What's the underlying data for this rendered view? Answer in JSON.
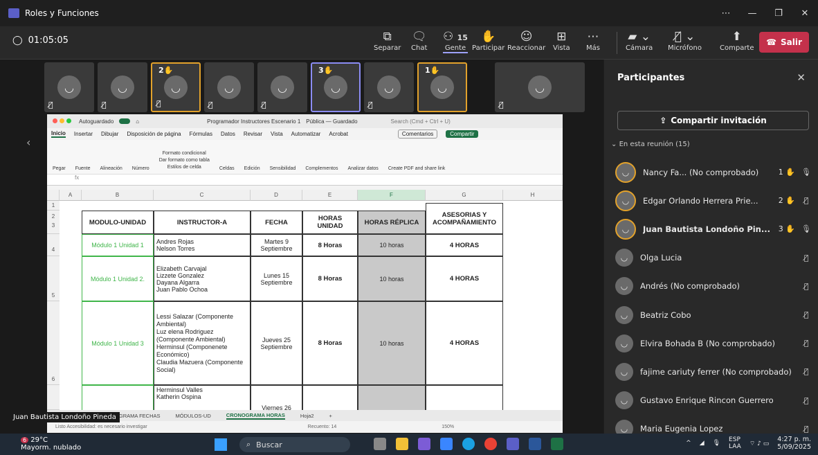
{
  "window": {
    "title": "Roles y Funciones"
  },
  "meeting": {
    "timer": "01:05:05",
    "tools": {
      "separar": "Separar",
      "chat": "Chat",
      "gente": "Gente",
      "gente_count": "15",
      "participar": "Participar",
      "reaccionar": "Reaccionar",
      "vista": "Vista",
      "mas": "Más",
      "camara": "Cámara",
      "microfono": "Micrófono",
      "comparte": "Comparte"
    },
    "leave_label": "Salir",
    "strip_hands": [
      "2",
      "3",
      "1"
    ],
    "speaker_label": "Juan Bautista Londoño Pineda"
  },
  "excel": {
    "autosave": "Autoguardado",
    "doc_title": "Programador Instructores Escenario 1",
    "doc_status": "Pública — Guardado",
    "search": "Search (Cmd + Ctrl + U)",
    "menu": [
      "Inicio",
      "Insertar",
      "Dibujar",
      "Disposición de página",
      "Fórmulas",
      "Datos",
      "Revisar",
      "Vista",
      "Automatizar",
      "Acrobat"
    ],
    "comentarios": "Comentarios",
    "compartir": "Compartir",
    "ribbon": [
      "Pegar",
      "Fuente",
      "Alineación",
      "Número",
      "Formato condicional",
      "Dar formato como tabla",
      "Estilos de celda",
      "Celdas",
      "Edición",
      "Sensibilidad",
      "Complementos",
      "Analizar datos",
      "Create PDF and share link"
    ],
    "fx": "fx",
    "columns": [
      "A",
      "B",
      "C",
      "D",
      "E",
      "F",
      "G",
      "H"
    ],
    "rows": [
      "1",
      "2",
      "3",
      "4",
      "5",
      "6"
    ],
    "headers": [
      "MODULO-UNIDAD",
      "INSTRUCTOR-A",
      "FECHA",
      "HORAS UNIDAD",
      "HORAS RÉPLICA",
      "ASESORIAS Y ACOMPAÑAMIENTO"
    ],
    "data": [
      {
        "modulo": "Módulo 1 Unidad 1",
        "instructor": "Andres Rojas\nNelson Torres",
        "fecha": "Martes 9 Septiembre",
        "horas": "8 Horas",
        "replica": "10 horas",
        "asesorias": "4 HORAS"
      },
      {
        "modulo": "Módulo 1 Unidad 2.",
        "instructor": "Elizabeth Carvajal\nLizzete Gonzalez\nDayana Algarra\nJuan Pablo Ochoa",
        "fecha": "Lunes 15 Septiembre",
        "horas": "8 Horas",
        "replica": "10 horas",
        "asesorias": "4 HORAS"
      },
      {
        "modulo": "Módulo 1 Unidad 3",
        "instructor": "Lessi Salazar (Componente Ambiental)\nLuz elena Rodriguez (Componente Ambiental)\nHerminsul (Componenete Económico)\nClaudia Mazuera (Componente Social)",
        "fecha": "Jueves 25 Septiembre",
        "horas": "8 Horas",
        "replica": "10 horas",
        "asesorias": "4 HORAS"
      },
      {
        "modulo": "",
        "instructor": "Herminsul Valles\nKatherin Ospina",
        "fecha": "Viernes 26",
        "horas": "",
        "replica": "",
        "asesorias": ""
      }
    ],
    "sheet_tabs": [
      "CRONOGRAMA FECHAS",
      "MÓDULOS-UD",
      "CRONOGRAMA HORAS",
      "Hoja2"
    ],
    "status_text": "Listo   Accesibilidad: es necesario investigar",
    "count": "Recuento: 14",
    "zoom": "150%"
  },
  "panel": {
    "title": "Participantes",
    "invite": "Compartir invitación",
    "section": "En esta reunión (15)",
    "participants": [
      {
        "name": "Nancy Fa... (No comprobado)",
        "hand": "1",
        "ring": true,
        "mic": "on"
      },
      {
        "name": "Edgar Orlando Herrera Prie...",
        "hand": "2",
        "ring": true,
        "mic": "off"
      },
      {
        "name": "Juan Bautista Londoño Pin...",
        "hand": "3",
        "ring": true,
        "mic": "on",
        "bold": true
      },
      {
        "name": "Olga Lucia",
        "hand": "",
        "mic": "off"
      },
      {
        "name": "Andrés (No comprobado)",
        "hand": "",
        "mic": "off"
      },
      {
        "name": "Beatriz Cobo",
        "hand": "",
        "mic": "off"
      },
      {
        "name": "Elvira Bohada B (No comprobado)",
        "hand": "",
        "mic": "off"
      },
      {
        "name": "fajime cariuty ferrer (No comprobado)",
        "hand": "",
        "mic": "off"
      },
      {
        "name": "Gustavo Enrique Rincon Guerrero",
        "hand": "",
        "mic": "off"
      },
      {
        "name": "Maria Eugenia Lopez",
        "hand": "",
        "mic": "off"
      }
    ]
  },
  "taskbar": {
    "weather_badge": "6",
    "temp": "29°C",
    "condition": "Mayorm. nublado",
    "search": "Buscar",
    "lang": "ESP",
    "lang2": "LAA",
    "time": "4:27 p. m.",
    "date": "5/09/2025"
  }
}
